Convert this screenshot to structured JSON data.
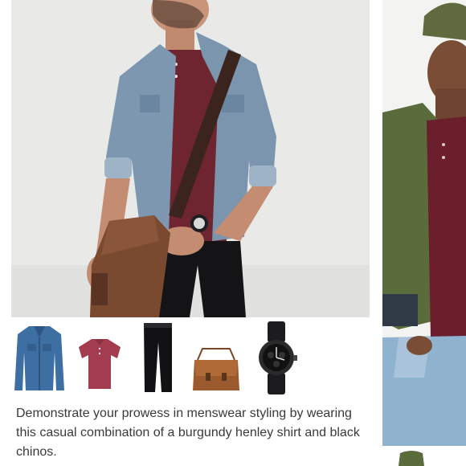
{
  "outfit": {
    "caption": "Demonstrate your prowess in menswear styling by wearing this casual combination of a burgundy henley shirt and black chinos.",
    "products": [
      {
        "icon": "denim-jacket-icon"
      },
      {
        "icon": "burgundy-henley-icon"
      },
      {
        "icon": "black-chinos-icon"
      },
      {
        "icon": "brown-messenger-bag-icon"
      },
      {
        "icon": "black-watch-icon"
      }
    ]
  },
  "colors": {
    "caption_text": "#3a3a3a",
    "burgundy": "#6e2530",
    "denim": "#6b8fb0",
    "olive": "#5a6b3c"
  }
}
